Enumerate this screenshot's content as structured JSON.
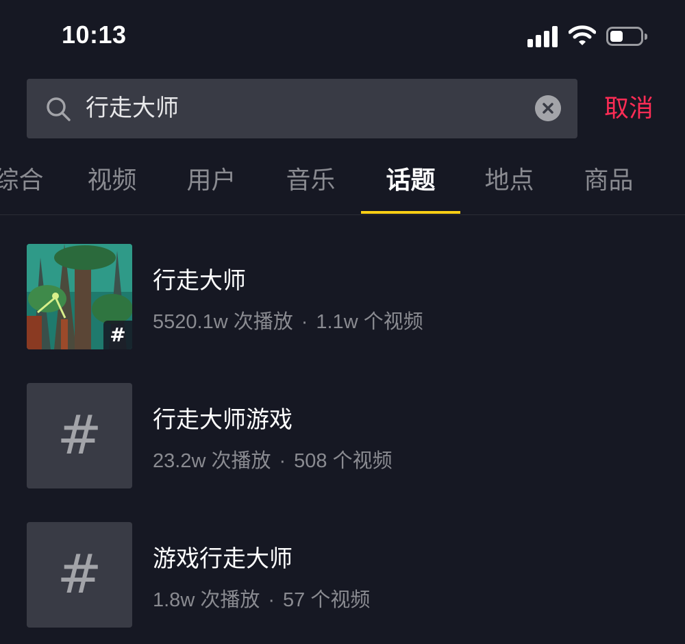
{
  "status_bar": {
    "time": "10:13",
    "icons": [
      "signal-icon",
      "wifi-icon",
      "battery-icon"
    ]
  },
  "search": {
    "query": "行走大师",
    "cancel_label": "取消"
  },
  "tabs": [
    {
      "label": "综合",
      "active": false
    },
    {
      "label": "视频",
      "active": false
    },
    {
      "label": "用户",
      "active": false
    },
    {
      "label": "音乐",
      "active": false
    },
    {
      "label": "话题",
      "active": true
    },
    {
      "label": "地点",
      "active": false
    },
    {
      "label": "商品",
      "active": false
    }
  ],
  "results": [
    {
      "title": "行走大师",
      "plays": "5520.1w 次播放",
      "videos": "1.1w 个视频",
      "thumbnail": "game-scene",
      "badge": "#"
    },
    {
      "title": "行走大师游戏",
      "plays": "23.2w 次播放",
      "videos": "508 个视频",
      "thumbnail": "hashtag",
      "badge": "#"
    },
    {
      "title": "游戏行走大师",
      "plays": "1.8w 次播放",
      "videos": "57 个视频",
      "thumbnail": "hashtag",
      "badge": "#"
    }
  ],
  "separator": "·",
  "colors": {
    "background": "#161823",
    "search_bg": "#393b45",
    "accent_cancel": "#fe2c55",
    "tab_indicator": "#face15",
    "muted_text": "#8a8b91"
  }
}
